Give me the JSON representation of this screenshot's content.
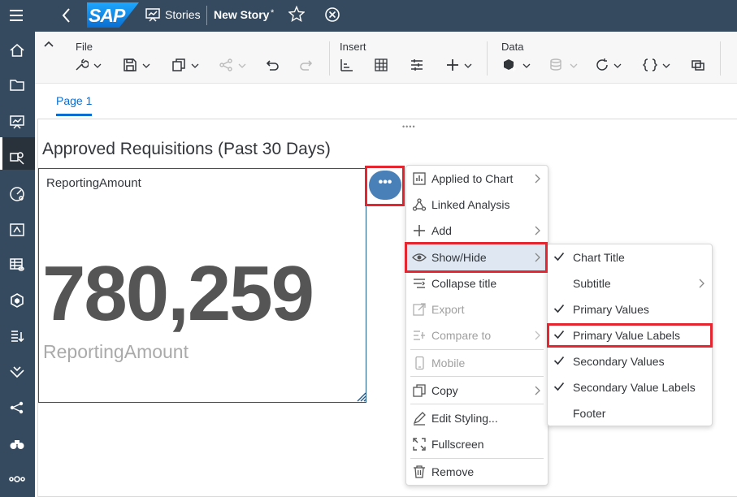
{
  "shell": {
    "app_title": "Stories",
    "story_title": "New Story",
    "dirty_marker": "*",
    "logo_text": "SAP"
  },
  "sidenav": {
    "icons": [
      "home-icon",
      "folder-icon",
      "stories-icon",
      "analytic-apps-icon",
      "analytics-designer-icon",
      "modeler-icon",
      "data-icon",
      "data-upload-icon",
      "transport-icon",
      "connections-icon",
      "explore-icon",
      "more-icon"
    ]
  },
  "toolbar": {
    "file_label": "File",
    "insert_label": "Insert",
    "data_label": "Data"
  },
  "tabs": {
    "page1": "Page 1"
  },
  "widget": {
    "title": "Approved Requisitions (Past 30 Days)",
    "tile_label": "ReportingAmount",
    "value": "780,259",
    "value_label": "ReportingAmount",
    "more_button": "•••"
  },
  "context_menu": {
    "items": [
      {
        "label": "Applied to Chart",
        "icon": "applied-chart-icon",
        "submenu": true,
        "disabled": false
      },
      {
        "label": "Linked Analysis",
        "icon": "linked-analysis-icon",
        "submenu": false,
        "disabled": false
      },
      {
        "label": "Add",
        "icon": "add-icon",
        "submenu": true,
        "disabled": false
      },
      {
        "label": "Show/Hide",
        "icon": "eye-icon",
        "submenu": true,
        "disabled": false
      },
      {
        "label": "Collapse title",
        "icon": "collapse-title-icon",
        "submenu": false,
        "disabled": false
      },
      {
        "label": "Export",
        "icon": "export-icon",
        "submenu": false,
        "disabled": true
      },
      {
        "label": "Compare to",
        "icon": "compare-icon",
        "submenu": true,
        "disabled": true
      },
      {
        "label": "Mobile",
        "icon": "mobile-icon",
        "submenu": false,
        "disabled": true
      },
      {
        "label": "Copy",
        "icon": "copy-icon",
        "submenu": true,
        "disabled": false
      },
      {
        "label": "Edit Styling...",
        "icon": "edit-styling-icon",
        "submenu": false,
        "disabled": false
      },
      {
        "label": "Fullscreen",
        "icon": "fullscreen-icon",
        "submenu": false,
        "disabled": false
      },
      {
        "label": "Remove",
        "icon": "trash-icon",
        "submenu": false,
        "disabled": false
      }
    ]
  },
  "showhide_menu": {
    "items": [
      {
        "label": "Chart Title",
        "checked": true,
        "submenu": false
      },
      {
        "label": "Subtitle",
        "checked": false,
        "submenu": true
      },
      {
        "label": "Primary Values",
        "checked": true,
        "submenu": false
      },
      {
        "label": "Primary Value Labels",
        "checked": true,
        "submenu": false
      },
      {
        "label": "Secondary Values",
        "checked": true,
        "submenu": false
      },
      {
        "label": "Secondary Value Labels",
        "checked": true,
        "submenu": false
      },
      {
        "label": "Footer",
        "checked": false,
        "submenu": false
      }
    ]
  },
  "colors": {
    "shell": "#354a5f",
    "accent": "#0a6ed1",
    "highlight": "#e3262f"
  }
}
